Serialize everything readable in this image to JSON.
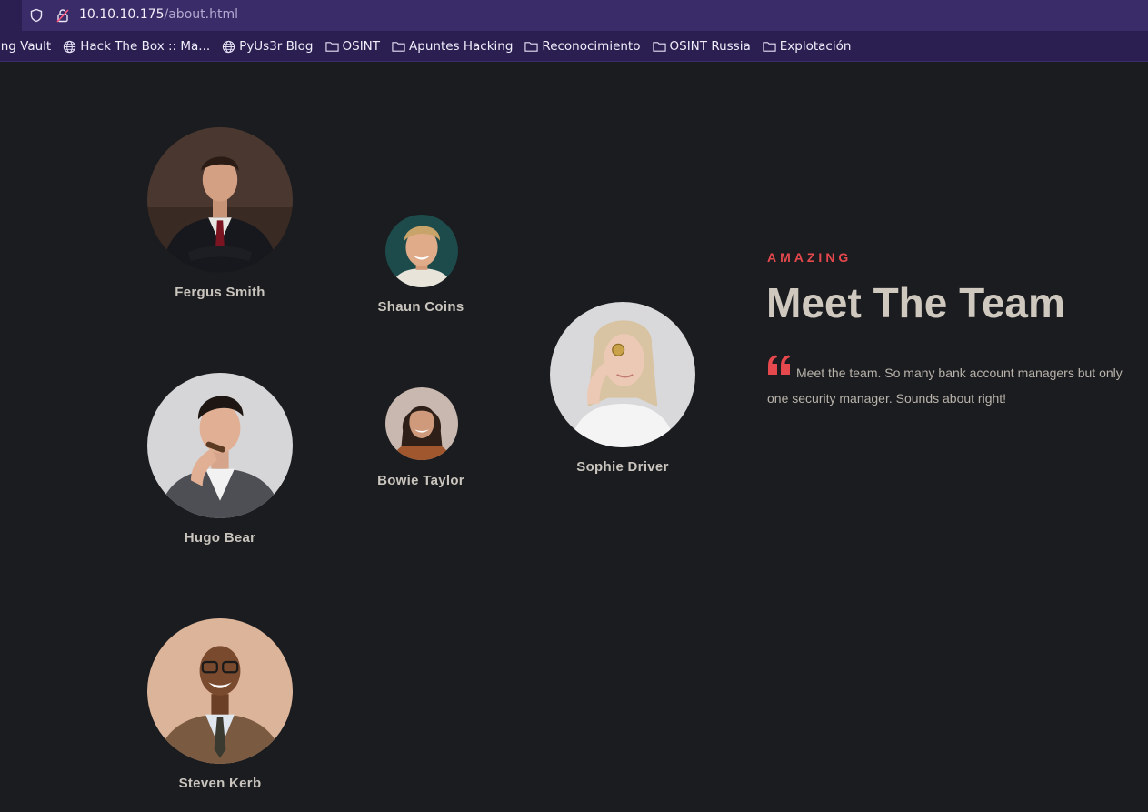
{
  "browser": {
    "url_host": "10.10.10.175",
    "url_path": "/about.html",
    "bookmarks": [
      {
        "label": "ing Vault",
        "icon": "none"
      },
      {
        "label": "Hack The Box :: Ma...",
        "icon": "globe-icon"
      },
      {
        "label": "PyUs3r Blog",
        "icon": "globe-icon"
      },
      {
        "label": "OSINT",
        "icon": "folder-icon"
      },
      {
        "label": "Apuntes Hacking",
        "icon": "folder-icon"
      },
      {
        "label": "Reconocimiento",
        "icon": "folder-icon"
      },
      {
        "label": "OSINT Russia",
        "icon": "folder-icon"
      },
      {
        "label": "Explotación",
        "icon": "folder-icon"
      }
    ]
  },
  "team": {
    "eyebrow": "AMAZING",
    "title": "Meet The Team",
    "quote": "Meet the team. So many bank account managers but only one security manager. Sounds about right!",
    "members": [
      {
        "name": "Fergus Smith"
      },
      {
        "name": "Shaun Coins"
      },
      {
        "name": "Sophie Driver"
      },
      {
        "name": "Hugo Bear"
      },
      {
        "name": "Bowie Taylor"
      },
      {
        "name": "Steven Kerb"
      }
    ]
  },
  "colors": {
    "accent": "#e5484d",
    "page_bg": "#1b1c1f",
    "chrome_bg": "#2b1f52"
  }
}
